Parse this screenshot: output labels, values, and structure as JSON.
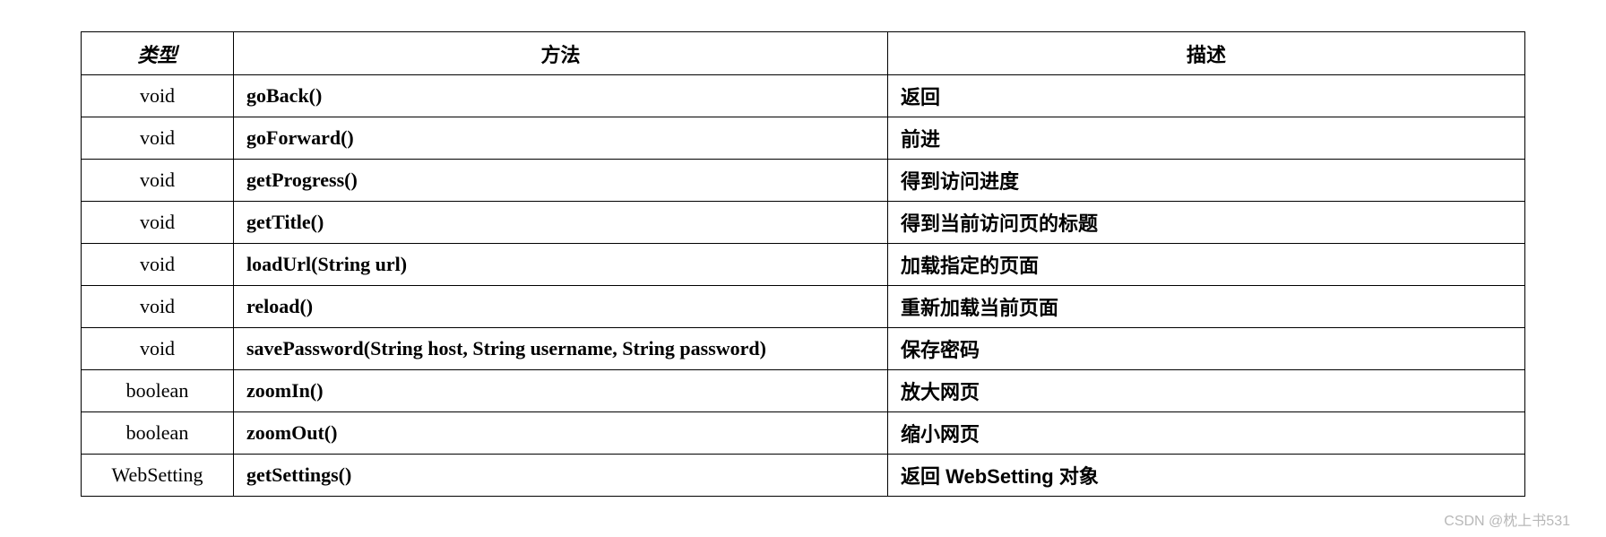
{
  "table": {
    "headers": {
      "type": "类型",
      "method": "方法",
      "description": "描述"
    },
    "rows": [
      {
        "type": "void",
        "method": "goBack()",
        "description": "返回"
      },
      {
        "type": "void",
        "method": "goForward()",
        "description": "前进"
      },
      {
        "type": "void",
        "method": "getProgress()",
        "description": "得到访问进度"
      },
      {
        "type": "void",
        "method": "getTitle()",
        "description": "得到当前访问页的标题"
      },
      {
        "type": "void",
        "method": "loadUrl(String url)",
        "description": "加载指定的页面"
      },
      {
        "type": "void",
        "method": "reload()",
        "description": "重新加载当前页面"
      },
      {
        "type": "void",
        "method": "savePassword(String host, String username, String password)",
        "description": "保存密码"
      },
      {
        "type": "boolean",
        "method": "zoomIn()",
        "description": "放大网页"
      },
      {
        "type": "boolean",
        "method": "zoomOut()",
        "description": "缩小网页"
      },
      {
        "type": "WebSetting",
        "method": "getSettings()",
        "description": "返回 WebSetting 对象"
      }
    ]
  },
  "watermark": "CSDN @枕上书531"
}
